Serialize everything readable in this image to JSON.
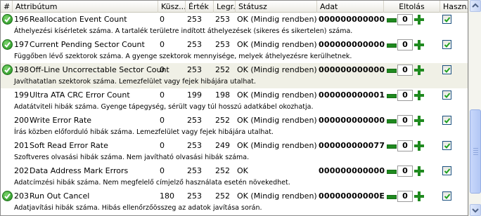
{
  "columns": {
    "num": "#",
    "attribute": "Attribútum",
    "threshold": "Küsz...",
    "value": "Érték",
    "worst": "Legr...",
    "status": "Státusz",
    "data": "Adat",
    "offset": "Eltolás",
    "use": "Haszn..."
  },
  "rows": [
    {
      "id": "196",
      "name": "Reallocation Event Count",
      "threshold": "0",
      "value": "253",
      "worst": "253",
      "status": "OK (Mindig rendben)",
      "data": "000000000000",
      "offset": "0",
      "ok_icon": true,
      "checked": true,
      "selected": false,
      "desc": "Áthelyezési kísérletek száma. A tartalék területre indított áthelyezések (sikeres és sikertelen) száma."
    },
    {
      "id": "197",
      "name": "Current Pending Sector Count",
      "threshold": "0",
      "value": "253",
      "worst": "253",
      "status": "OK (Mindig rendben)",
      "data": "000000000000",
      "offset": "0",
      "ok_icon": true,
      "checked": true,
      "selected": false,
      "desc": "Függőben lévő szektorok száma. A gyenge szektorok mennyisége, melyek áthelyezésre kerülhetnek."
    },
    {
      "id": "198",
      "name": "Off-Line Uncorrectable Sector Count",
      "threshold": "0",
      "value": "253",
      "worst": "252",
      "status": "OK (Mindig rendben)",
      "data": "000000000000",
      "offset": "0",
      "ok_icon": true,
      "checked": true,
      "selected": true,
      "desc": "Javíthatatlan szektorok száma. Lemezfelület vagy fejek hibájára utalhat."
    },
    {
      "id": "199",
      "name": "Ultra ATA CRC Error Count",
      "threshold": "0",
      "value": "199",
      "worst": "198",
      "status": "OK (Mindig rendben)",
      "data": "000000000001",
      "offset": "0",
      "ok_icon": false,
      "checked": true,
      "selected": false,
      "desc": "Adatátviteli hibák száma. Gyenge tápegység, sérült vagy túl hosszú adatkábel okozhatja."
    },
    {
      "id": "200",
      "name": "Write Error Rate",
      "threshold": "0",
      "value": "253",
      "worst": "252",
      "status": "OK (Mindig rendben)",
      "data": "000000000000",
      "offset": "0",
      "ok_icon": false,
      "checked": true,
      "selected": false,
      "desc": "Írás közben előforduló hibák száma. Lemezfelület vagy fejek hibájára utalhat."
    },
    {
      "id": "201",
      "name": "Soft Read Error Rate",
      "threshold": "0",
      "value": "253",
      "worst": "249",
      "status": "OK (Mindig rendben)",
      "data": "000000000077",
      "offset": "0",
      "ok_icon": false,
      "checked": true,
      "selected": false,
      "desc": "Szoftveres olvasási hibák száma. Nem javítható olvasási hibák száma."
    },
    {
      "id": "202",
      "name": "Data Address Mark Errors",
      "threshold": "0",
      "value": "253",
      "worst": "252",
      "status": "OK",
      "data": "000000000000",
      "offset": "0",
      "ok_icon": false,
      "checked": true,
      "selected": false,
      "desc": "Adatcímzési hibák száma. Nem megfelelő címjelző használata esetén növekedhet."
    },
    {
      "id": "203",
      "name": "Run Out Cancel",
      "threshold": "180",
      "value": "253",
      "worst": "252",
      "status": "OK (Mindig rendben)",
      "data": "00000000000E",
      "offset": "0",
      "ok_icon": true,
      "checked": true,
      "selected": false,
      "desc": "Adatjavítási hibák száma. Hibás ellenőrzőösszeg az adatok javítása során."
    }
  ],
  "colors": {
    "selected_row": "#f0f0e6",
    "ok_green": "#1d8d1a",
    "accent": "#1c5180"
  }
}
